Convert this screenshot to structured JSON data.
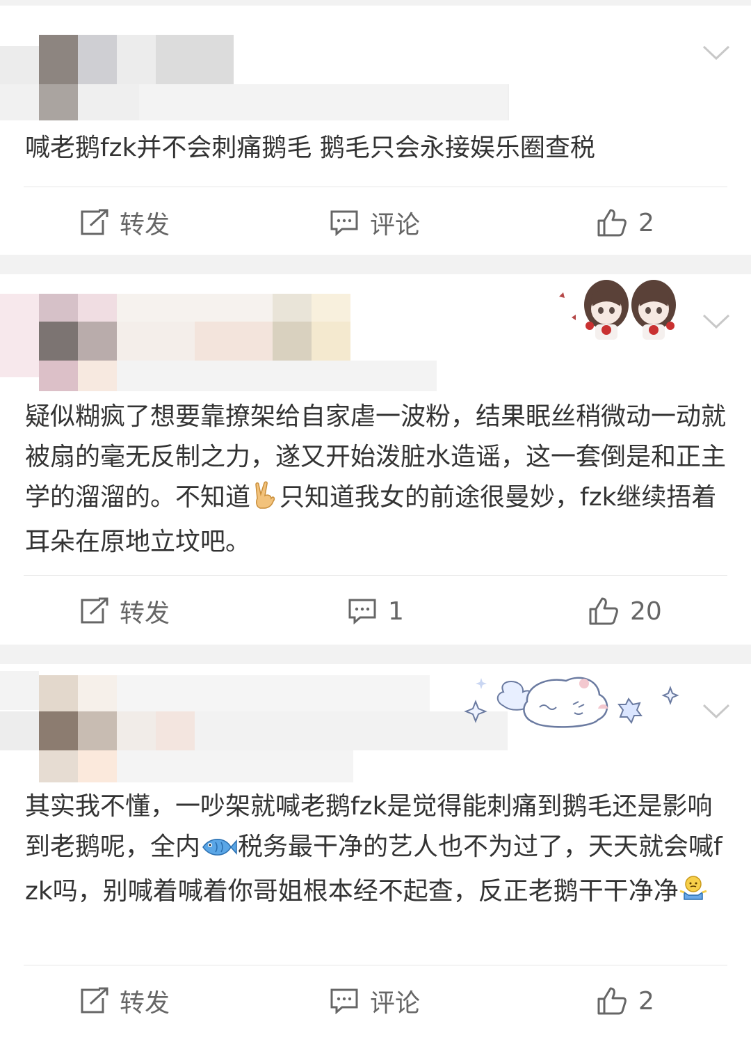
{
  "colors": {
    "text": "#333333",
    "meta": "#666666",
    "background": "#f2f2f2",
    "card": "#ffffff",
    "divider": "#e6e6e6"
  },
  "posts": [
    {
      "text": "喊老鹅fzk并不会刺痛鹅毛 鹅毛只会永接娱乐圈查税",
      "actions": {
        "repost": "转发",
        "comment": "评论",
        "like": "2"
      }
    },
    {
      "text_parts": [
        "疑似糊疯了想要靠撩架给自家虐一波粉，结果眠丝稍微动一动就被扇的毫无反制之力，遂又开始泼脏水造谣，这一套倒是和正主学的溜溜的。不知道",
        "只知道我女的前途很曼妙，fzk继续捂着耳朵在原地立坟吧。"
      ],
      "inline_emoji": "victory-hand-emoji",
      "sticker": "anime-twins-sticker",
      "actions": {
        "repost": "转发",
        "comment": "1",
        "like": "20"
      }
    },
    {
      "text_parts": [
        "其实我不懂，一吵架就喊老鹅fzk是觉得能刺痛到鹅毛还是影响到老鹅呢，全内",
        "税务最干净的艺人也不为过了，天天就会喊fzk吗，别喊着喊着你哥姐根本经不起查，反正老鹅干干净净"
      ],
      "inline_emojis": [
        "fish-emoji",
        "shrug-emoji"
      ],
      "sticker": "sleepy-cat-cloud-sticker",
      "actions": {
        "repost": "转发",
        "comment": "评论",
        "like": "2"
      }
    }
  ],
  "icons": {
    "repost": "repost-icon",
    "comment": "comment-icon",
    "like": "thumbs-up-icon",
    "menu": "chevron-down-icon"
  }
}
